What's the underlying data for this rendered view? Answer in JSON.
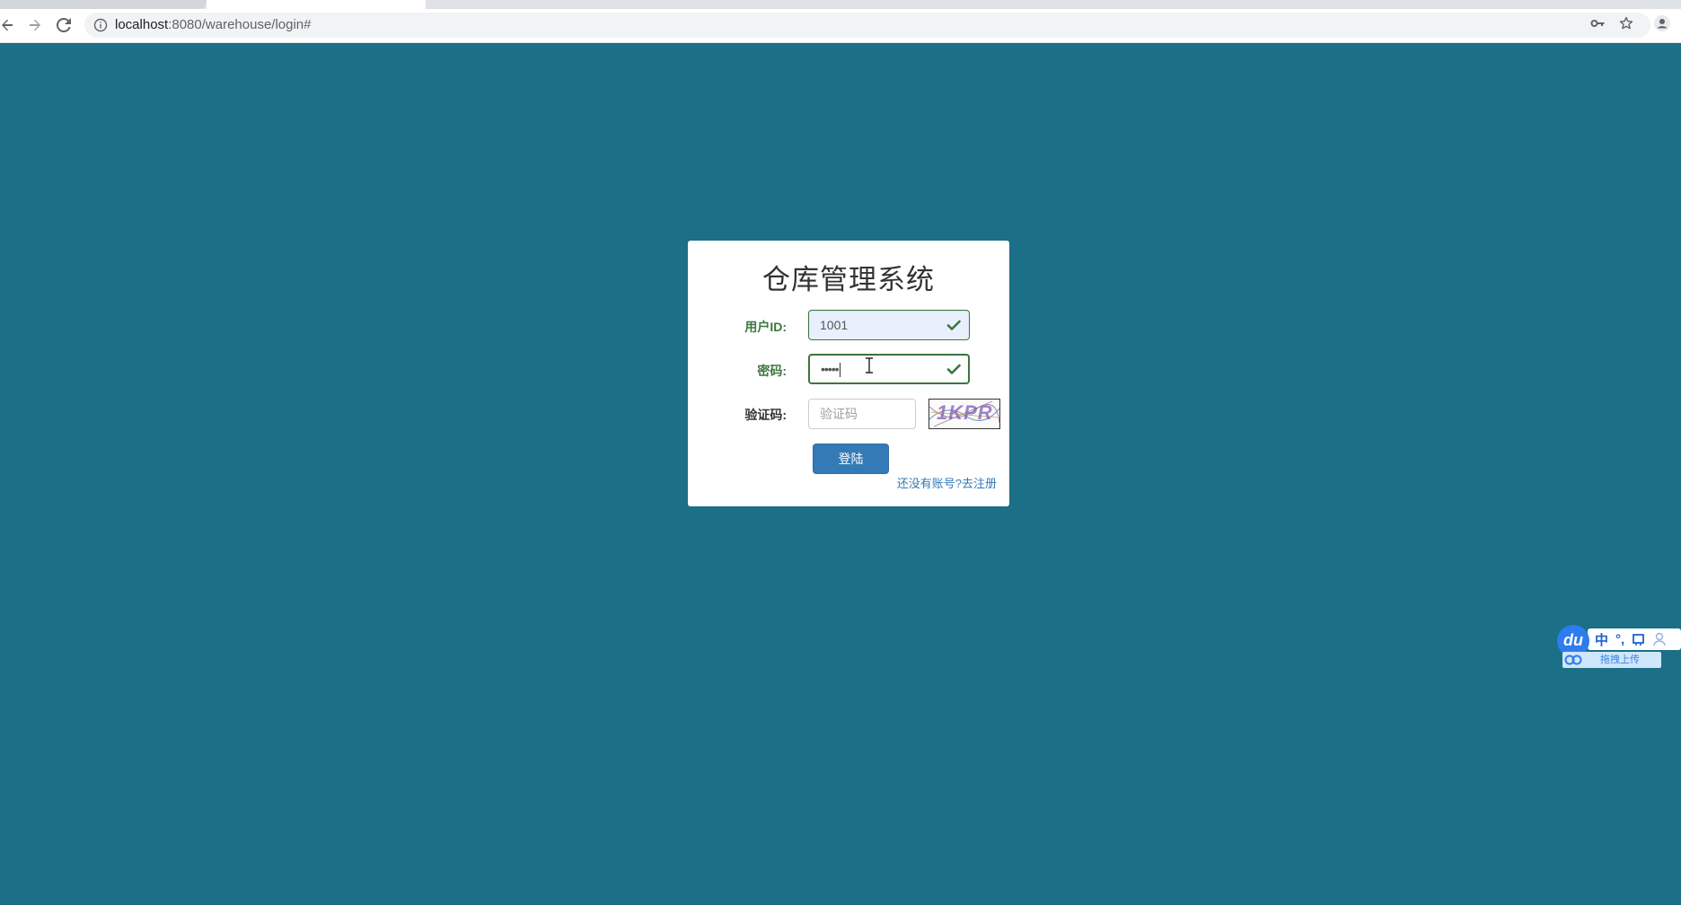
{
  "browser": {
    "url_host": "localhost",
    "url_path": ":8080/warehouse/login#"
  },
  "login": {
    "title": "仓库管理系统",
    "user_label": "用户ID:",
    "user_value": "1001",
    "password_label": "密码:",
    "password_value": "•••••",
    "captcha_label": "验证码:",
    "captcha_placeholder": "验证码",
    "captcha_text": "1KPR",
    "login_button": "登陆",
    "register_link": "还没有账号?去注册"
  },
  "ime": {
    "logo": "du",
    "mode": "中",
    "punct": "°,",
    "upload_label": "拖拽上传"
  },
  "colors": {
    "page_background": "#1b6f87",
    "success_green": "#3c763d",
    "primary_blue": "#337ab7"
  }
}
